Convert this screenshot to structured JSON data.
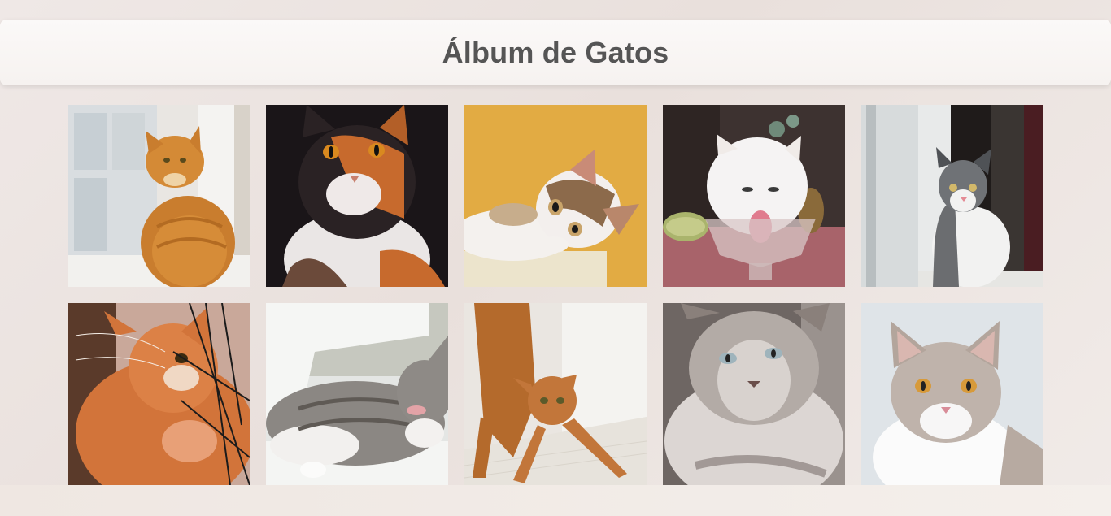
{
  "header": {
    "title": "Álbum de Gatos"
  },
  "gallery": {
    "photos": [
      {
        "subject": "orange-tabby-by-window"
      },
      {
        "subject": "calico-in-dark"
      },
      {
        "subject": "calico-on-yellow"
      },
      {
        "subject": "white-cat-drinking"
      },
      {
        "subject": "gray-white-cat-window"
      },
      {
        "subject": "orange-cat-on-net"
      },
      {
        "subject": "gray-cat-licking"
      },
      {
        "subject": "ginger-cat-stretching"
      },
      {
        "subject": "fluffy-gray-cat"
      },
      {
        "subject": "lilac-cat-light-bg"
      }
    ]
  },
  "colors": {
    "title": "#555555",
    "header_bg": "#faf8f7",
    "page_bg": "#ebe3df"
  }
}
